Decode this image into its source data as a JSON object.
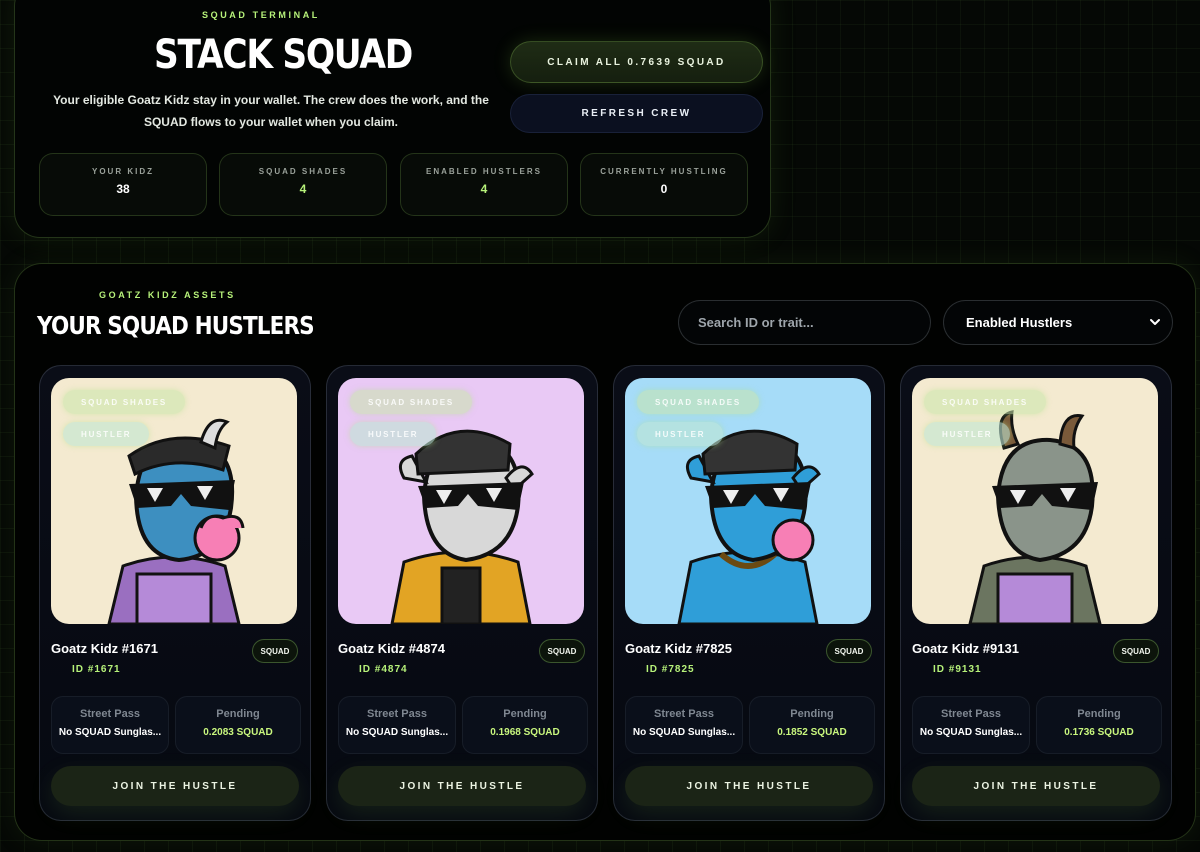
{
  "terminal": {
    "eyebrow": "SQUAD TERMINAL",
    "title": "STACK SQUAD",
    "description": "Your eligible Goatz Kidz stay in your wallet. The crew does the work, and the SQUAD flows to your wallet when you claim.",
    "claim_label": "CLAIM ALL 0.7639 SQUAD",
    "refresh_label": "REFRESH CREW",
    "stats": [
      {
        "label": "YOUR KIDZ",
        "value": "38"
      },
      {
        "label": "SQUAD SHADES",
        "value": "4"
      },
      {
        "label": "ENABLED HUSTLERS",
        "value": "4"
      },
      {
        "label": "CURRENTLY HUSTLING",
        "value": "0"
      }
    ]
  },
  "assets": {
    "eyebrow": "GOATZ KIDZ ASSETS",
    "title": "YOUR SQUAD HUSTLERS",
    "search_placeholder": "Search ID or trait...",
    "filter_value": "Enabled Hustlers",
    "cards": [
      {
        "name": "Goatz Kidz #1671",
        "id": "ID #1671",
        "badge": "SQUAD",
        "tag_shades": "SQUAD SHADES",
        "tag_hustler": "HUSTLER",
        "street_pass_label": "Street Pass",
        "street_pass_value": "No SQUAD Sunglas...",
        "pending_label": "Pending",
        "pending_value": "0.2083 SQUAD",
        "join_label": "JOIN THE HUSTLE",
        "art_bg": "#f4ead0"
      },
      {
        "name": "Goatz Kidz #4874",
        "id": "ID #4874",
        "badge": "SQUAD",
        "tag_shades": "SQUAD SHADES",
        "tag_hustler": "HUSTLER",
        "street_pass_label": "Street Pass",
        "street_pass_value": "No SQUAD Sunglas...",
        "pending_label": "Pending",
        "pending_value": "0.1968 SQUAD",
        "join_label": "JOIN THE HUSTLE",
        "art_bg": "#e9c9f5"
      },
      {
        "name": "Goatz Kidz #7825",
        "id": "ID #7825",
        "badge": "SQUAD",
        "tag_shades": "SQUAD SHADES",
        "tag_hustler": "HUSTLER",
        "street_pass_label": "Street Pass",
        "street_pass_value": "No SQUAD Sunglas...",
        "pending_label": "Pending",
        "pending_value": "0.1852 SQUAD",
        "join_label": "JOIN THE HUSTLE",
        "art_bg": "#a6dcf8"
      },
      {
        "name": "Goatz Kidz #9131",
        "id": "ID #9131",
        "badge": "SQUAD",
        "tag_shades": "SQUAD SHADES",
        "tag_hustler": "HUSTLER",
        "street_pass_label": "Street Pass",
        "street_pass_value": "No SQUAD Sunglas...",
        "pending_label": "Pending",
        "pending_value": "0.1736 SQUAD",
        "join_label": "JOIN THE HUSTLE",
        "art_bg": "#f4ead0"
      }
    ]
  },
  "colors": {
    "accent": "#b7f27a",
    "panel_bg": "#020403",
    "card_bg": "#0a0d17"
  }
}
